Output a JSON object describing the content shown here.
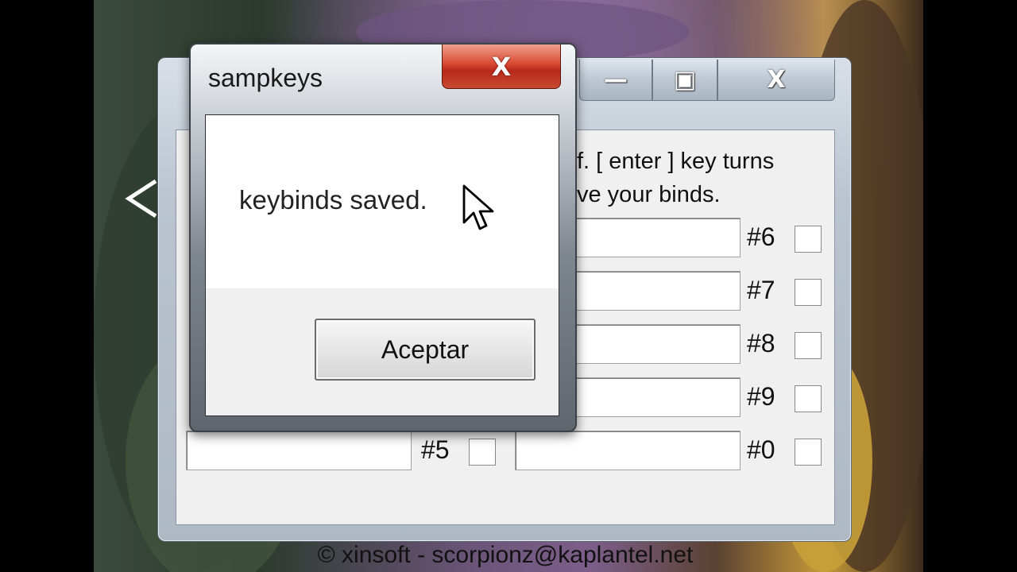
{
  "main_window": {
    "instructions_line1": "f. [ enter ] key turns",
    "instructions_line2": "ve your binds.",
    "caption_buttons": {
      "minimize": "—",
      "maximize": "▣",
      "close": "X"
    },
    "left_row_label": "#5",
    "right_row_labels": [
      "#6",
      "#7",
      "#8",
      "#9",
      "#0"
    ],
    "copyright": "© xinsoft - scorpionz@kaplantel.net"
  },
  "dialog": {
    "title": "sampkeys",
    "close_glyph": "X",
    "message": "keybinds saved.",
    "ok_label": "Aceptar"
  }
}
